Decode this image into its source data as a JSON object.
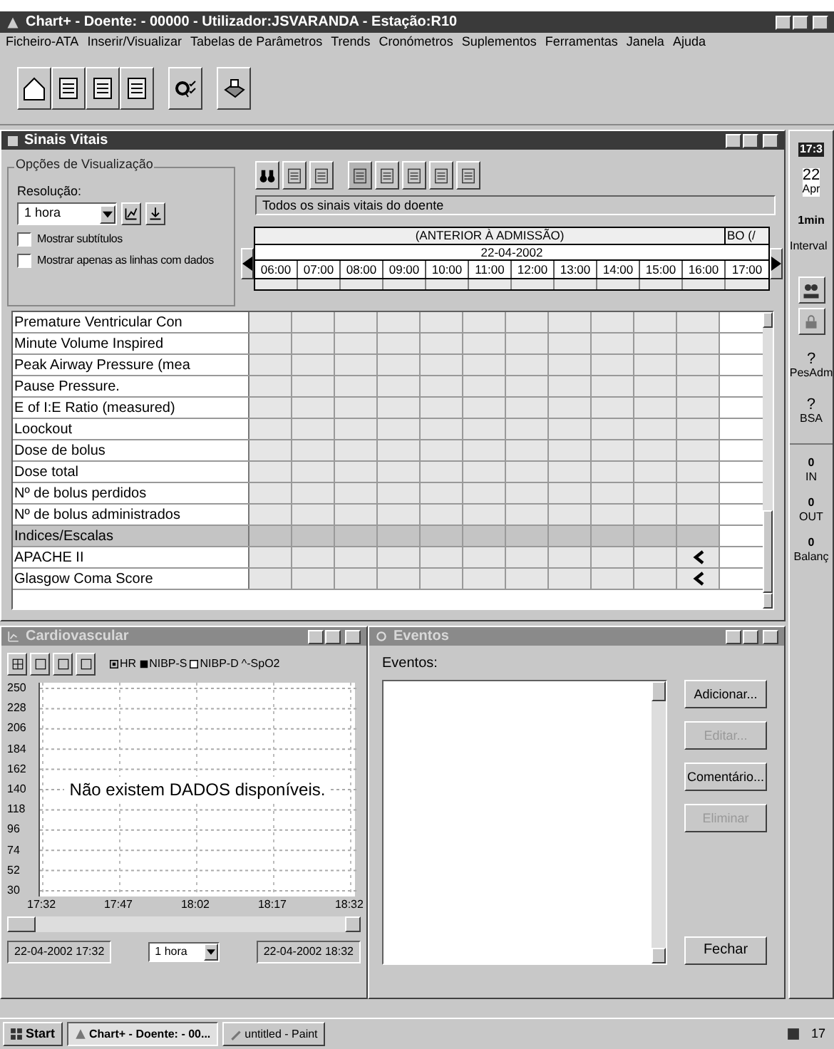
{
  "window": {
    "title": "Chart+ - Doente: - 00000 - Utilizador:JSVARANDA - Estação:R10"
  },
  "menu": [
    "Ficheiro-ATA",
    "Inserir/Visualizar",
    "Tabelas de Parâmetros",
    "Trends",
    "Cronómetros",
    "Suplementos",
    "Ferramentas",
    "Janela",
    "Ajuda"
  ],
  "vitals": {
    "title": "Sinais Vitais",
    "options": {
      "legend": "Opções de Visualização",
      "resolution_label": "Resolução:",
      "resolution": "1 hora",
      "checkboxes": [
        {
          "label": "Mostrar subtítulos",
          "checked": false
        },
        {
          "label": "Mostrar apenas as linhas com dados",
          "checked": false
        }
      ]
    },
    "filter": "Todos os sinais vitais do doente",
    "period": "(ANTERIOR À ADMISSÃO)",
    "period_next": "BO (/",
    "date": "22-04-2002",
    "hours": [
      "06:00",
      "07:00",
      "08:00",
      "09:00",
      "10:00",
      "11:00",
      "12:00",
      "13:00",
      "14:00",
      "15:00",
      "16:00",
      "17:00"
    ],
    "rows": [
      {
        "label": "Premature Ventricular Con",
        "kind": "param",
        "flagged": false
      },
      {
        "label": "Minute Volume Inspired",
        "kind": "param",
        "flagged": false
      },
      {
        "label": "Peak Airway Pressure (mea",
        "kind": "param",
        "flagged": false
      },
      {
        "label": "Pause Pressure.",
        "kind": "param",
        "flagged": false
      },
      {
        "label": "E of I:E Ratio (measured)",
        "kind": "param",
        "flagged": false
      },
      {
        "label": "Loockout",
        "kind": "param",
        "flagged": false
      },
      {
        "label": "Dose de bolus",
        "kind": "param",
        "flagged": false
      },
      {
        "label": "Dose total",
        "kind": "param",
        "flagged": false
      },
      {
        "label": "Nº de bolus perdidos",
        "kind": "param",
        "flagged": false
      },
      {
        "label": "Nº de bolus administrados",
        "kind": "param",
        "flagged": false
      },
      {
        "label": "Indices/Escalas",
        "kind": "section",
        "flagged": false
      },
      {
        "label": "APACHE II",
        "kind": "param",
        "flagged": true
      },
      {
        "label": "Glasgow Coma Score",
        "kind": "param",
        "flagged": true
      }
    ]
  },
  "side_panel": {
    "time": "17:3",
    "day": "22",
    "month": "Apr",
    "interval": "1min",
    "interval_label": "Interval",
    "measures": [
      {
        "value": "?",
        "label": "PesAdm"
      },
      {
        "value": "?",
        "label": "BSA"
      }
    ],
    "balance": [
      {
        "value": "0",
        "label": "IN"
      },
      {
        "value": "0",
        "label": "OUT"
      },
      {
        "value": "0",
        "label": "Balanç"
      }
    ]
  },
  "cardio": {
    "title": "Cardiovascular",
    "message": "Não existem DADOS disponíveis.",
    "chart_data": {
      "type": "line",
      "grid": true,
      "x": [
        "17:32",
        "17:47",
        "18:02",
        "18:17",
        "18:32"
      ],
      "ylim": [
        30,
        250
      ],
      "yticks": [
        30,
        52,
        74,
        96,
        118,
        140,
        162,
        184,
        206,
        228,
        250
      ],
      "series": [
        {
          "name": "HR",
          "marker": "dot",
          "values": [
            null,
            null,
            null,
            null,
            null
          ]
        },
        {
          "name": "NIBP-S",
          "marker": "filled",
          "values": [
            null,
            null,
            null,
            null,
            null
          ]
        },
        {
          "name": "NIBP-D",
          "marker": "hollow",
          "values": [
            null,
            null,
            null,
            null,
            null
          ]
        },
        {
          "name": "^-SpO2",
          "marker": "text",
          "values": [
            null,
            null,
            null,
            null,
            null
          ]
        }
      ]
    },
    "start": "22-04-2002 17:32",
    "range": "1 hora",
    "end": "22-04-2002 18:32"
  },
  "events": {
    "title": "Eventos",
    "label": "Eventos:",
    "buttons": [
      {
        "label": "Adicionar...",
        "disabled": false
      },
      {
        "label": "Editar...",
        "disabled": true
      },
      {
        "label": "Comentário...",
        "disabled": false
      },
      {
        "label": "Eliminar",
        "disabled": true
      }
    ],
    "close": "Fechar"
  },
  "taskbar": {
    "start": "Start",
    "tasks": [
      {
        "label": "Chart+ - Doente: - 00...",
        "selected": true,
        "kind": "chart"
      },
      {
        "label": "untitled - Paint",
        "selected": false,
        "kind": "paint"
      }
    ],
    "clock": "17"
  }
}
